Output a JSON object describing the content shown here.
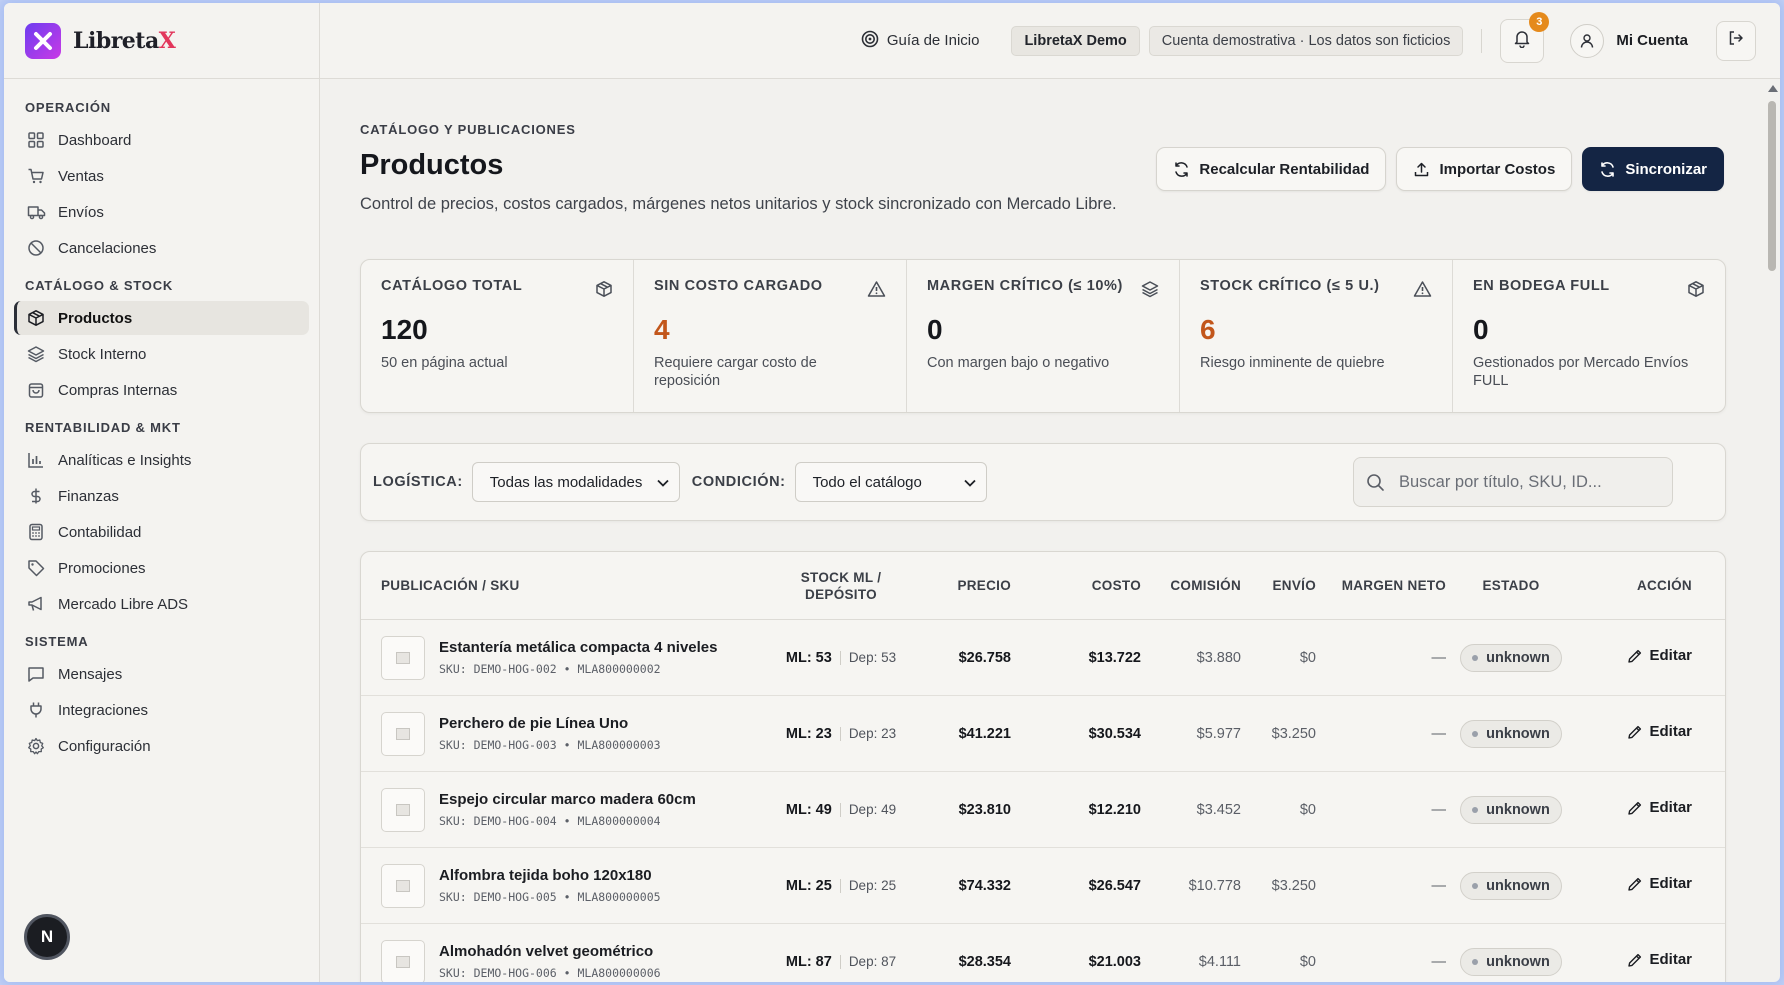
{
  "brand": {
    "name_main": "Libreta",
    "name_accent": "X"
  },
  "sidebar": {
    "sections": [
      {
        "title": "OPERACIÓN",
        "items": [
          {
            "label": "Dashboard",
            "icon": "grid-icon"
          },
          {
            "label": "Ventas",
            "icon": "cart-icon"
          },
          {
            "label": "Envíos",
            "icon": "truck-icon"
          },
          {
            "label": "Cancelaciones",
            "icon": "ban-icon"
          }
        ]
      },
      {
        "title": "CATÁLOGO & STOCK",
        "items": [
          {
            "label": "Productos",
            "icon": "box-icon",
            "active": true
          },
          {
            "label": "Stock Interno",
            "icon": "layers-icon"
          },
          {
            "label": "Compras Internas",
            "icon": "bag-icon"
          }
        ]
      },
      {
        "title": "RENTABILIDAD & MKT",
        "items": [
          {
            "label": "Analíticas e Insights",
            "icon": "bar-chart-icon"
          },
          {
            "label": "Finanzas",
            "icon": "dollar-icon"
          },
          {
            "label": "Contabilidad",
            "icon": "calculator-icon"
          },
          {
            "label": "Promociones",
            "icon": "tag-icon"
          },
          {
            "label": "Mercado Libre ADS",
            "icon": "megaphone-icon"
          }
        ]
      },
      {
        "title": "SISTEMA",
        "items": [
          {
            "label": "Mensajes",
            "icon": "message-icon"
          },
          {
            "label": "Integraciones",
            "icon": "plug-icon"
          },
          {
            "label": "Configuración",
            "icon": "gear-icon"
          }
        ]
      }
    ],
    "user_initial": "N"
  },
  "header": {
    "guide_label": "Guía de Inicio",
    "demo_label": "LibretaX Demo",
    "demo_note": "Cuenta demostrativa · Los datos son ficticios",
    "notifications": "3",
    "account_label": "Mi Cuenta"
  },
  "page": {
    "kicker": "CATÁLOGO Y PUBLICACIONES",
    "title": "Productos",
    "subtitle": "Control de precios, costos cargados, márgenes netos unitarios y stock sincronizado con Mercado Libre.",
    "actions": {
      "recalc": "Recalcular Rentabilidad",
      "import": "Importar Costos",
      "sync": "Sincronizar"
    }
  },
  "kpis": [
    {
      "label": "CATÁLOGO TOTAL",
      "value": "120",
      "sub": "50 en página actual",
      "icon": "box-icon",
      "warn": false
    },
    {
      "label": "SIN COSTO CARGADO",
      "value": "4",
      "sub": "Requiere cargar costo de reposición",
      "icon": "warning-icon",
      "warn": true
    },
    {
      "label": "MARGEN CRÍTICO (≤ 10%)",
      "value": "0",
      "sub": "Con margen bajo o negativo",
      "icon": "layers-icon",
      "warn": false
    },
    {
      "label": "STOCK CRÍTICO (≤ 5 U.)",
      "value": "6",
      "sub": "Riesgo inminente de quiebre",
      "icon": "warning-icon",
      "warn": true
    },
    {
      "label": "EN BODEGA FULL",
      "value": "0",
      "sub": "Gestionados por Mercado Envíos FULL",
      "icon": "box-icon",
      "warn": false
    }
  ],
  "filters": {
    "logistics_label": "LOGÍSTICA:",
    "logistics_value": "Todas las modalidades",
    "condition_label": "CONDICIÓN:",
    "condition_value": "Todo el catálogo",
    "search_placeholder": "Buscar por título, SKU, ID..."
  },
  "table": {
    "headers": {
      "pub": "PUBLICACIÓN / SKU",
      "stock": "STOCK ML / DEPÓSITO",
      "price": "PRECIO",
      "cost": "COSTO",
      "commission": "COMISIÓN",
      "shipping": "ENVÍO",
      "margin": "MARGEN NETO",
      "status": "ESTADO",
      "action": "ACCIÓN"
    },
    "rows": [
      {
        "name": "Estantería metálica compacta 4 niveles",
        "sku": "SKU: DEMO-HOG-002 • MLA800000002",
        "ml": "ML: 53",
        "dep": "Dep: 53",
        "price": "$26.758",
        "cost": "$13.722",
        "commission": "$3.880",
        "shipping": "$0",
        "margin": "—",
        "status": "unknown",
        "action": "Editar"
      },
      {
        "name": "Perchero de pie Línea Uno",
        "sku": "SKU: DEMO-HOG-003 • MLA800000003",
        "ml": "ML: 23",
        "dep": "Dep: 23",
        "price": "$41.221",
        "cost": "$30.534",
        "commission": "$5.977",
        "shipping": "$3.250",
        "margin": "—",
        "status": "unknown",
        "action": "Editar"
      },
      {
        "name": "Espejo circular marco madera 60cm",
        "sku": "SKU: DEMO-HOG-004 • MLA800000004",
        "ml": "ML: 49",
        "dep": "Dep: 49",
        "price": "$23.810",
        "cost": "$12.210",
        "commission": "$3.452",
        "shipping": "$0",
        "margin": "—",
        "status": "unknown",
        "action": "Editar"
      },
      {
        "name": "Alfombra tejida boho 120x180",
        "sku": "SKU: DEMO-HOG-005 • MLA800000005",
        "ml": "ML: 25",
        "dep": "Dep: 25",
        "price": "$74.332",
        "cost": "$26.547",
        "commission": "$10.778",
        "shipping": "$3.250",
        "margin": "—",
        "status": "unknown",
        "action": "Editar"
      },
      {
        "name": "Almohadón velvet geométrico",
        "sku": "SKU: DEMO-HOG-006 • MLA800000006",
        "ml": "ML: 87",
        "dep": "Dep: 87",
        "price": "$28.354",
        "cost": "$21.003",
        "commission": "$4.111",
        "shipping": "$0",
        "margin": "—",
        "status": "unknown",
        "action": "Editar"
      }
    ]
  },
  "colors": {
    "accent_dark": "#142544",
    "warn": "#c2561b",
    "badge": "#e58a1c",
    "brand_x": "#e2365b"
  }
}
